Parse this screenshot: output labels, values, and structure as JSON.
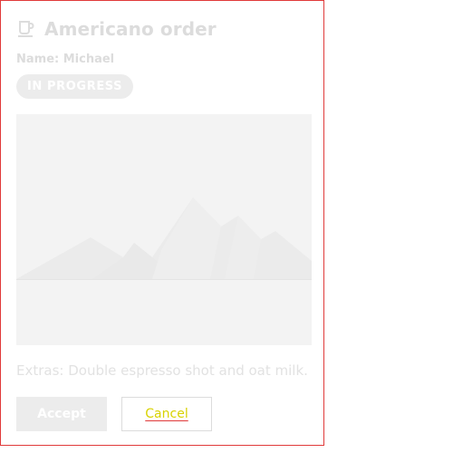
{
  "order": {
    "title": "Americano order",
    "title_icon": "coffee-cup-icon",
    "name_line": "Name: Michael",
    "status": "IN PROGRESS",
    "image_placeholder_icon": "mountain-landscape-placeholder",
    "extras": "Extras: Double espresso shot and oat milk.",
    "accept_label": "Accept",
    "cancel_label": "Cancel"
  },
  "colors": {
    "card_border": "#e03a3a",
    "muted_text": "#dcdcdc",
    "badge_bg": "#ececec",
    "image_bg": "#f3f3f3",
    "cancel_text": "#d8d200"
  }
}
